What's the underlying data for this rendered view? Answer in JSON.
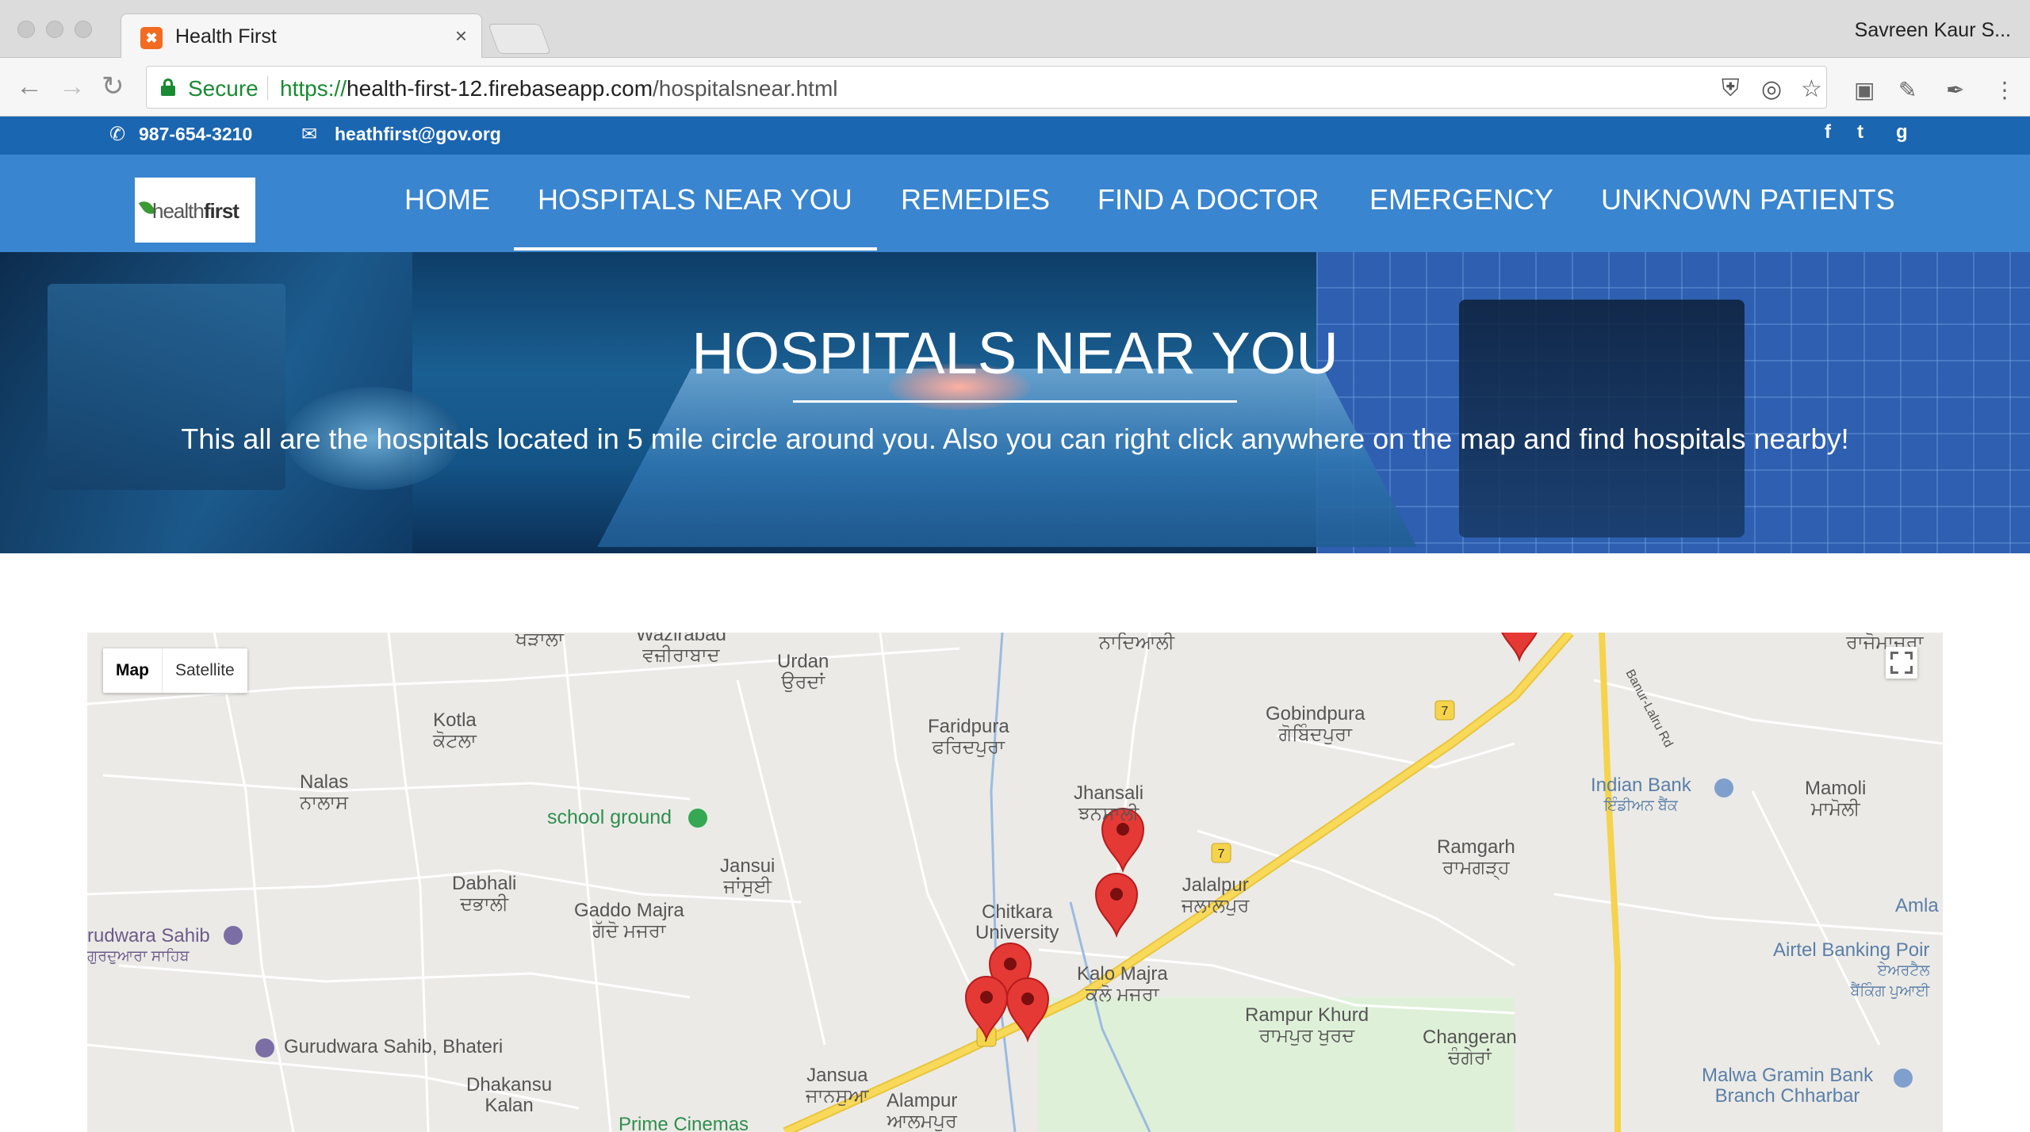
{
  "browser": {
    "tab_title": "Health First",
    "tab_close": "×",
    "user": "Savreen Kaur S...",
    "secure_label": "Secure",
    "url_scheme": "https://",
    "url_host": "health-first-12.firebaseapp.com",
    "url_path": "/hospitalsnear.html"
  },
  "topbar": {
    "phone": "987-654-3210",
    "email": "heathfirst@gov.org",
    "social": [
      "f",
      "t",
      "g"
    ]
  },
  "logo": {
    "text_light": "health",
    "text_bold": "first"
  },
  "nav": {
    "items": [
      "HOME",
      "HOSPITALS NEAR YOU",
      "REMEDIES",
      "FIND A DOCTOR",
      "EMERGENCY",
      "UNKNOWN PATIENTS"
    ],
    "active": "HOSPITALS NEAR YOU"
  },
  "hero": {
    "title": "HOSPITALS NEAR YOU",
    "subtitle": "This all are the hospitals located in 5 mile circle around you. Also you can right click anywhere on the map and find hospitals nearby!"
  },
  "map": {
    "type_map": "Map",
    "type_satellite": "Satellite",
    "highway_badge": "7",
    "road_label": "Banur-Lalru Rd",
    "places": [
      {
        "name": "ਖੜਾਲਾ",
        "sub": ""
      },
      {
        "name": "Wazirabad",
        "sub": "ਵਜ਼ੀਰਾਬਾਦ"
      },
      {
        "name": "Urdan",
        "sub": "ਉਰਦਾਂ"
      },
      {
        "name": "ਨਾਦਿਆਲੀ",
        "sub": ""
      },
      {
        "name": "ਰਾਜੋਮਾਜਰਾ",
        "sub": ""
      },
      {
        "name": "Kotla",
        "sub": "ਕੋਟਲਾ"
      },
      {
        "name": "Faridpura",
        "sub": "ਫਰਿਦਪੁਰਾ"
      },
      {
        "name": "Gobindpura",
        "sub": "ਗੋਬਿੰਦਪੁਰਾ"
      },
      {
        "name": "Nalas",
        "sub": "ਨਾਲਾਸ"
      },
      {
        "name": "Jhansali",
        "sub": "ਝਨਸਾਲੀ"
      },
      {
        "name": "Mamoli",
        "sub": "ਮਾਮੋਲੀ"
      },
      {
        "name": "Ramgarh",
        "sub": "ਰਾਮਗੜ੍ਹ"
      },
      {
        "name": "Jansui",
        "sub": "ਜਾਂਸੁਈ"
      },
      {
        "name": "Dabhali",
        "sub": "ਦਭਾਲੀ"
      },
      {
        "name": "Gaddo Majra",
        "sub": "ਗੱਦੋ ਮਜਰਾ"
      },
      {
        "name": "Jalalpur",
        "sub": "ਜਲਾਲਪੁਰ"
      },
      {
        "name": "Chitkara",
        "sub": "University"
      },
      {
        "name": "Kalo Majra",
        "sub": "ਕਲੋ ਮਜਰਾ"
      },
      {
        "name": "Rampur Khurd",
        "sub": "ਰਾਮਪੁਰ ਖੁਰਦ"
      },
      {
        "name": "Changeran",
        "sub": "ਚੰਗੇਰਾਂ"
      },
      {
        "name": "Dhakansu",
        "sub": "Kalan"
      },
      {
        "name": "Jansua",
        "sub": "ਜਾਨਸੁਆ"
      },
      {
        "name": "Alampur",
        "sub": "ਆਲਮਪੁਰ"
      },
      {
        "name": "Amla",
        "sub": ""
      },
      {
        "name": "Prime Cinemas",
        "sub": ""
      }
    ],
    "pois": [
      {
        "name": "school ground"
      },
      {
        "name": "rudwara Sahib",
        "sub": "ਗੁਰਦੁਆਰਾ ਸਾਹਿਬ"
      },
      {
        "name": "Gurudwara Sahib, Bhateri"
      },
      {
        "name": "Indian Bank",
        "sub": "ਇੰਡੀਅਨ ਬੈਂਕ"
      },
      {
        "name": "Airtel Banking Poir",
        "sub": "ਏਅਰਟੈਲ",
        "sub2": "ਬੈਂਕਿੰਗ ਪੁਆਈ"
      },
      {
        "name": "Malwa Gramin Bank",
        "sub": "Branch Chharbar"
      }
    ],
    "marker_count": 6
  },
  "colors": {
    "topbar": "#1b66b1",
    "navbar": "#3a85cf",
    "marker": "#e53935",
    "highway": "#f5d34b"
  }
}
